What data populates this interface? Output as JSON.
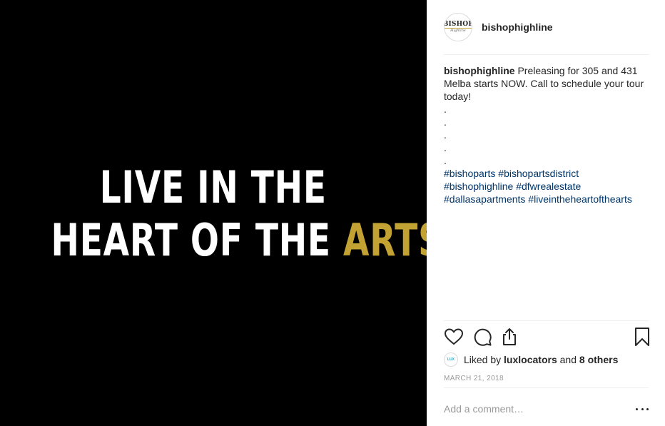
{
  "post": {
    "image_text": {
      "line1": "LIVE IN THE",
      "line2_white": "HEART OF THE ",
      "line2_gold": "ARTS"
    },
    "avatar_logo": {
      "name": "BISHOP",
      "sub": "Highline"
    },
    "username": "bishophighline",
    "caption": {
      "username": "bishophighline",
      "text": "Preleasing for 305 and 431 Melba starts NOW. Call to schedule your tour today!",
      "dots": [
        ".",
        ".",
        ".",
        ".",
        "."
      ],
      "hashtags": [
        "#bishoparts",
        "#bishopartsdistrict",
        "#bishophighline",
        "#dfwrealestate",
        "#dallasapartments",
        "#liveintheheartofthearts"
      ]
    },
    "likes": {
      "prefix": "Liked by ",
      "user": "luxlocators",
      "middle": " and ",
      "others": "8 others",
      "avatar_text": "LUX"
    },
    "date": "MARCH 21, 2018",
    "comment_placeholder": "Add a comment…"
  },
  "colors": {
    "accent_gold": "#c2a232",
    "hashtag_blue": "#003569"
  }
}
